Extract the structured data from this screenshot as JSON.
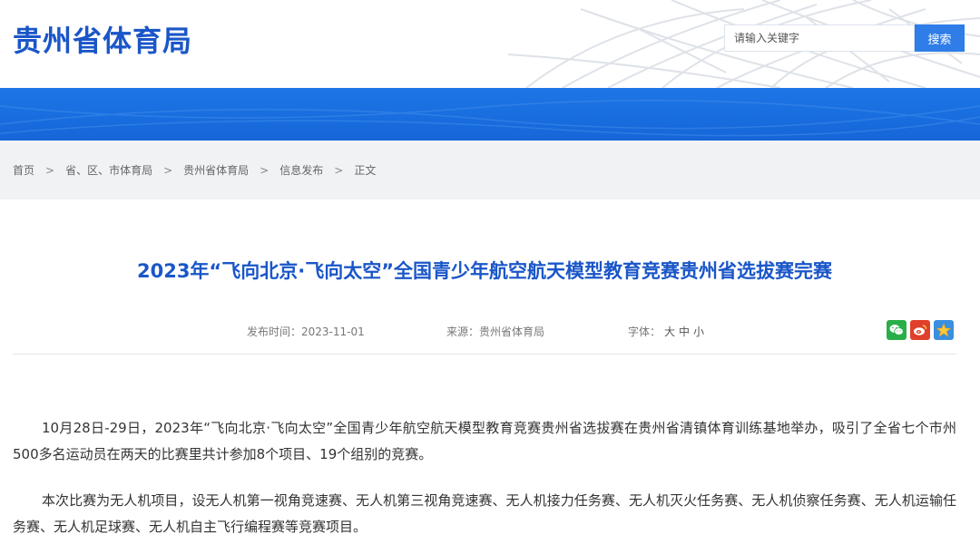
{
  "header": {
    "site_title": "贵州省体育局",
    "search_placeholder": "请输入关键字",
    "search_button": "搜索"
  },
  "breadcrumb": [
    "首页",
    "省、区、市体育局",
    "贵州省体育局",
    "信息发布",
    "正文"
  ],
  "breadcrumb_separator": ">",
  "article": {
    "title": "2023年“飞向北京·飞向太空”全国青少年航空航天模型教育竞赛贵州省选拔赛完赛",
    "publish_label": "发布时间：",
    "publish_date": "2023-11-01",
    "source_label": "来源：",
    "source": "贵州省体育局",
    "font_label": "字体：",
    "font_sizes": [
      "大",
      "中",
      "小"
    ],
    "paragraphs": [
      "10月28日-29日，2023年“飞向北京·飞向太空”全国青少年航空航天模型教育竞赛贵州省选拔赛在贵州省清镇体育训练基地举办，吸引了全省七个市州500多名运动员在两天的比赛里共计参加8个项目、19个组别的竞赛。",
      "本次比赛为无人机项目，设无人机第一视角竞速赛、无人机第三视角竞速赛、无人机接力任务赛、无人机灭火任务赛、无人机侦察任务赛、无人机运输任务赛、无人机足球赛、无人机自主飞行编程赛等竞赛项目。"
    ]
  },
  "share_icons": [
    "wechat-icon",
    "weibo-icon",
    "favorite-star-icon"
  ],
  "colors": {
    "brand_blue": "#1a56c8",
    "banner_blue": "#1d76e6",
    "search_button": "#2e7de8",
    "breadcrumb_bg": "#f1f2f4"
  }
}
